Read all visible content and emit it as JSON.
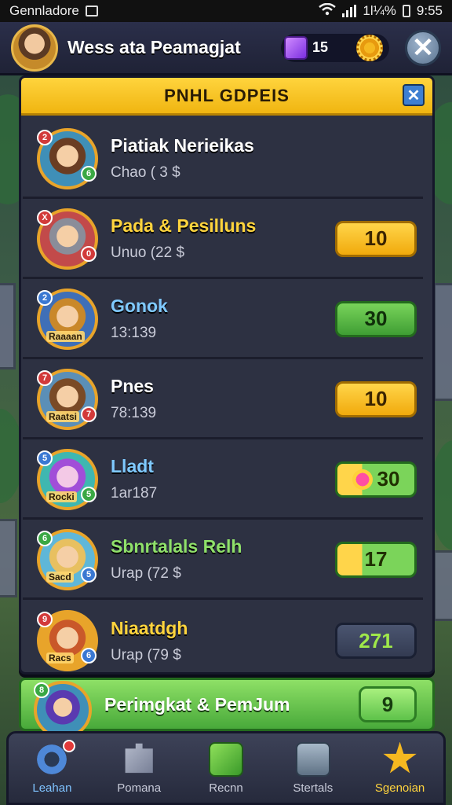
{
  "status_bar": {
    "carrier": "Gennladore",
    "status_text": "1l¼%",
    "time": "9:55"
  },
  "header": {
    "title": "Wess ata Peamagjat",
    "gems": "15"
  },
  "panel": {
    "title": "PNHL GDPEIS",
    "rows": [
      {
        "name": "Piatiak Nerieikas",
        "sub": "Chao ( 3 $",
        "button": ""
      },
      {
        "name": "Pada & Pesilluns",
        "sub": "Unuo (22 $",
        "button": "10"
      },
      {
        "name": "Gonok",
        "sub": "13:139",
        "button": "30",
        "avatar_tag": "Raaaan"
      },
      {
        "name": "Pnes",
        "sub": "78:139",
        "button": "10",
        "avatar_tag": "Raatsi"
      },
      {
        "name": "Lladt",
        "sub": "1ar187",
        "button": "30",
        "avatar_tag": "Rocki"
      },
      {
        "name": "Sbnrtalals Relh",
        "sub": "Urap (72 $",
        "button": "17",
        "avatar_tag": "Sacd"
      },
      {
        "name": "Niaatdgh",
        "sub": "Urap (79 $",
        "button": "271",
        "avatar_tag": "Racs"
      }
    ]
  },
  "promo": {
    "name": "Perimgkat & PemJum",
    "button": "9"
  },
  "nav": {
    "items": [
      {
        "label": "Leahan"
      },
      {
        "label": "Pomana"
      },
      {
        "label": "Recnn"
      },
      {
        "label": "Stertals"
      },
      {
        "label": "Sgenoian"
      }
    ]
  },
  "colors": {
    "accent_gold": "#ffd43d",
    "button_green": "#48a93a",
    "panel_bg": "#2d3142"
  }
}
